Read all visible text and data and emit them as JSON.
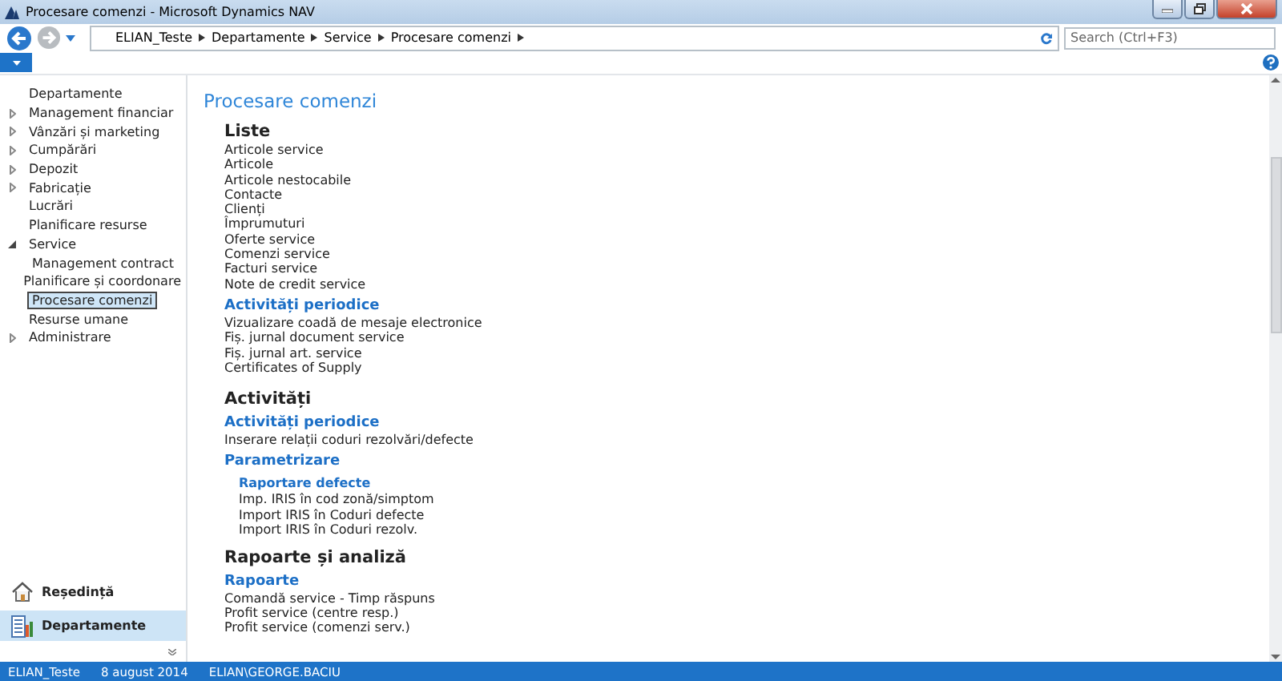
{
  "window": {
    "title": "Procesare comenzi - Microsoft Dynamics NAV"
  },
  "breadcrumb": [
    "ELIAN_Teste",
    "Departamente",
    "Service",
    "Procesare comenzi"
  ],
  "search": {
    "placeholder": "Search (Ctrl+F3)"
  },
  "navigation": [
    {
      "label": "Departamente",
      "kind": "leaf",
      "selected": false
    },
    {
      "label": "Management financiar",
      "kind": "folder",
      "expanded": false,
      "selected": false
    },
    {
      "label": "Vânzări și marketing",
      "kind": "folder",
      "expanded": false,
      "selected": false
    },
    {
      "label": "Cumpărări",
      "kind": "folder",
      "expanded": false,
      "selected": false
    },
    {
      "label": "Depozit",
      "kind": "folder",
      "expanded": false,
      "selected": false
    },
    {
      "label": "Fabricație",
      "kind": "folder",
      "expanded": false,
      "selected": false
    },
    {
      "label": "Lucrări",
      "kind": "leaf",
      "selected": false
    },
    {
      "label": "Planificare resurse",
      "kind": "leaf",
      "selected": false
    },
    {
      "label": "Service",
      "kind": "folder",
      "expanded": true,
      "selected": false,
      "children": [
        {
          "label": "Management contract",
          "selected": false
        },
        {
          "label": "Planificare și coordonare",
          "selected": false
        },
        {
          "label": "Procesare comenzi",
          "selected": true
        }
      ]
    },
    {
      "label": "Resurse umane",
      "kind": "leaf",
      "selected": false
    },
    {
      "label": "Administrare",
      "kind": "folder",
      "expanded": false,
      "selected": false
    }
  ],
  "navigation_panes": [
    {
      "label": "Reședință",
      "kind": "home",
      "selected": false
    },
    {
      "label": "Departamente",
      "kind": "departments",
      "selected": true
    }
  ],
  "page_title": "Procesare comenzi",
  "content": [
    {
      "kind": "section",
      "text": "Liste"
    },
    {
      "kind": "link",
      "text": "Articole service"
    },
    {
      "kind": "link",
      "text": "Articole"
    },
    {
      "kind": "link",
      "text": "Articole nestocabile"
    },
    {
      "kind": "link",
      "text": "Contacte"
    },
    {
      "kind": "link",
      "text": "Clienți"
    },
    {
      "kind": "link",
      "text": "Împrumuturi"
    },
    {
      "kind": "link",
      "text": "Oferte service"
    },
    {
      "kind": "link",
      "text": "Comenzi service"
    },
    {
      "kind": "link",
      "text": "Facturi service"
    },
    {
      "kind": "link",
      "text": "Note de credit service"
    },
    {
      "kind": "group",
      "text": "Activități periodice"
    },
    {
      "kind": "link",
      "text": "Vizualizare coadă de mesaje electronice"
    },
    {
      "kind": "link",
      "text": "Fiș. jurnal document service"
    },
    {
      "kind": "link",
      "text": "Fiș. jurnal art. service"
    },
    {
      "kind": "link",
      "text": "Certificates of Supply"
    },
    {
      "kind": "section",
      "text": "Activități"
    },
    {
      "kind": "group",
      "text": "Activități periodice"
    },
    {
      "kind": "link",
      "text": "Inserare relații coduri rezolvări/defecte"
    },
    {
      "kind": "group",
      "text": "Parametrizare"
    },
    {
      "kind": "subgroup",
      "text": "Raportare defecte"
    },
    {
      "kind": "sublink",
      "text": "Imp. IRIS în cod zonă/simptom"
    },
    {
      "kind": "sublink",
      "text": "Import IRIS în Coduri defecte"
    },
    {
      "kind": "sublink",
      "text": "Import IRIS în Coduri rezolv."
    },
    {
      "kind": "section",
      "text": "Rapoarte și analiză"
    },
    {
      "kind": "group",
      "text": "Rapoarte"
    },
    {
      "kind": "link",
      "text": "Comandă service - Timp răspuns"
    },
    {
      "kind": "link",
      "text": "Profit service (centre resp.)"
    },
    {
      "kind": "link",
      "text": "Profit service (comenzi serv.)"
    }
  ],
  "status_bar": [
    "ELIAN_Teste",
    "8 august 2014",
    "ELIAN\\GEORGE.BACIU"
  ]
}
